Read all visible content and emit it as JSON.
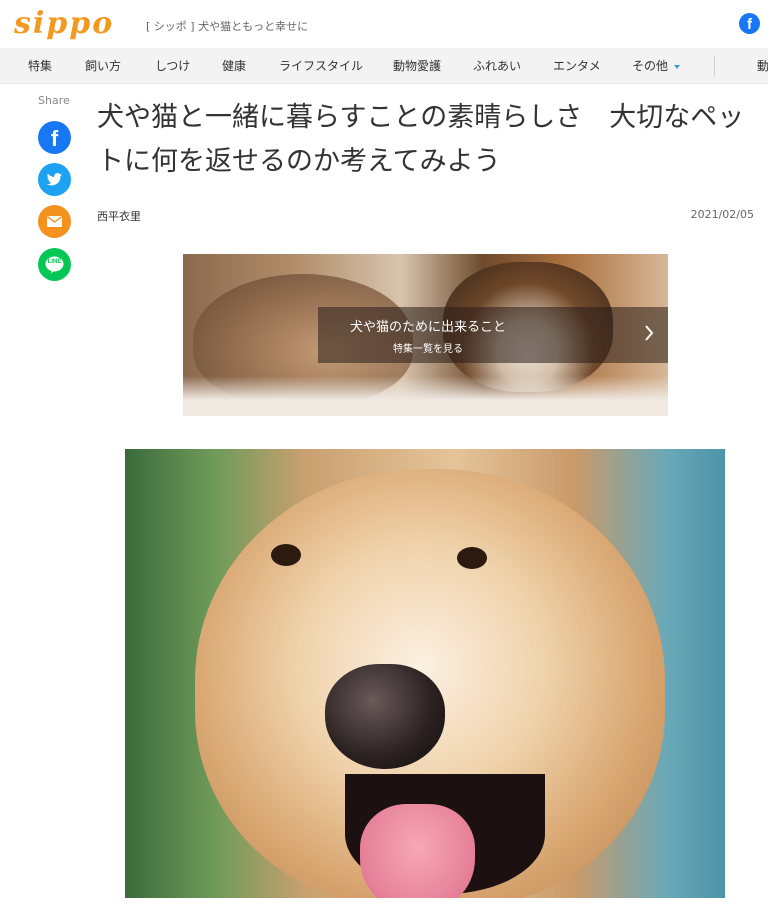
{
  "header": {
    "logo": "sippo",
    "tagline": "[ シッポ ] 犬や猫ともっと幸せに",
    "facebook_icon": "facebook-icon"
  },
  "nav": {
    "items": [
      {
        "label": "特集"
      },
      {
        "label": "飼い方"
      },
      {
        "label": "しつけ"
      },
      {
        "label": "健康"
      },
      {
        "label": "ライフスタイル"
      },
      {
        "label": "動物愛護"
      },
      {
        "label": "ふれあい"
      },
      {
        "label": "エンタメ"
      },
      {
        "label": "その他"
      },
      {
        "label": "動"
      }
    ]
  },
  "share": {
    "label": "Share",
    "buttons": [
      "facebook-icon",
      "twitter-icon",
      "mail-icon",
      "line-icon"
    ],
    "line_text": "LINE"
  },
  "article": {
    "title": "犬や猫と一緒に暮らすことの素晴らしさ　大切なペットに何を返せるのか考えてみよう",
    "author": "西平衣里",
    "date": "2021/02/05"
  },
  "banner": {
    "title": "犬や猫のために出来ること",
    "subtitle": "特集一覧を見る"
  },
  "colors": {
    "brand": "#f29a1f",
    "facebook": "#1877f2",
    "twitter": "#1da1f2",
    "mail": "#f5921e",
    "line": "#06c755",
    "nav_bg": "#f3f3f3",
    "nav_caret": "#3aa0c8"
  }
}
